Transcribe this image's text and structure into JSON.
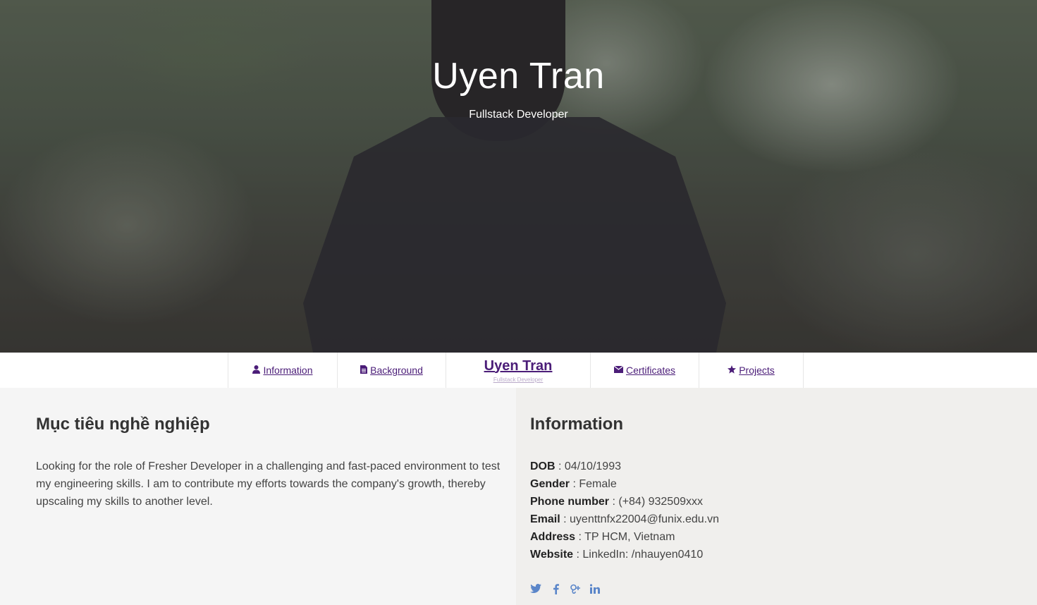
{
  "hero": {
    "title": "Uyen Tran",
    "subtitle": "Fullstack Developer"
  },
  "nav": {
    "items": [
      {
        "label": "Information",
        "icon": "user-icon"
      },
      {
        "label": "Background",
        "icon": "file-icon"
      },
      {
        "label": "Certificates",
        "icon": "envelope-icon"
      },
      {
        "label": "Projects",
        "icon": "star-icon"
      }
    ],
    "brand": {
      "name": "Uyen Tran",
      "subtitle": "Fullstack Developer"
    }
  },
  "objective": {
    "title": "Mục tiêu nghề nghiệp",
    "text": "Looking for the role of Fresher Developer in a challenging and fast-paced environment to test my engineering skills. I am to contribute my efforts towards the company's growth, thereby upscaling my skills to another level."
  },
  "information": {
    "title": "Information",
    "rows": [
      {
        "label": "DOB",
        "value": "04/10/1993"
      },
      {
        "label": "Gender",
        "value": "Female"
      },
      {
        "label": "Phone number",
        "value": "(+84) 932509xxx"
      },
      {
        "label": "Email",
        "value": "uyenttnfx22004@funix.edu.vn"
      },
      {
        "label": "Address",
        "value": "TP HCM, Vietnam"
      },
      {
        "label": "Website",
        "value": "LinkedIn: /nhauyen0410"
      }
    ],
    "social": [
      "twitter-icon",
      "facebook-icon",
      "google-plus-icon",
      "linkedin-icon"
    ]
  },
  "colors": {
    "accent": "#4b1d78",
    "social": "#5b86c9"
  }
}
